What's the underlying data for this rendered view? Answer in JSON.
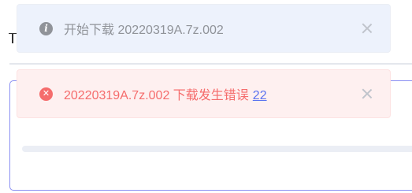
{
  "notifications": [
    {
      "type": "info",
      "icon": "info-icon",
      "message": "开始下载 20220319A.7z.002",
      "close_icon": "close-icon"
    },
    {
      "type": "error",
      "icon": "error-circle-icon",
      "message": "20220319A.7z.002 下载发生错误",
      "link_text": "22",
      "close_icon": "close-icon"
    }
  ],
  "colors": {
    "info_bg": "#edf2fc",
    "info_text": "#909399",
    "error_bg": "#fef0f0",
    "error_text": "#f56c6c",
    "link": "#5b73f0"
  },
  "progress": {
    "value": 0
  }
}
